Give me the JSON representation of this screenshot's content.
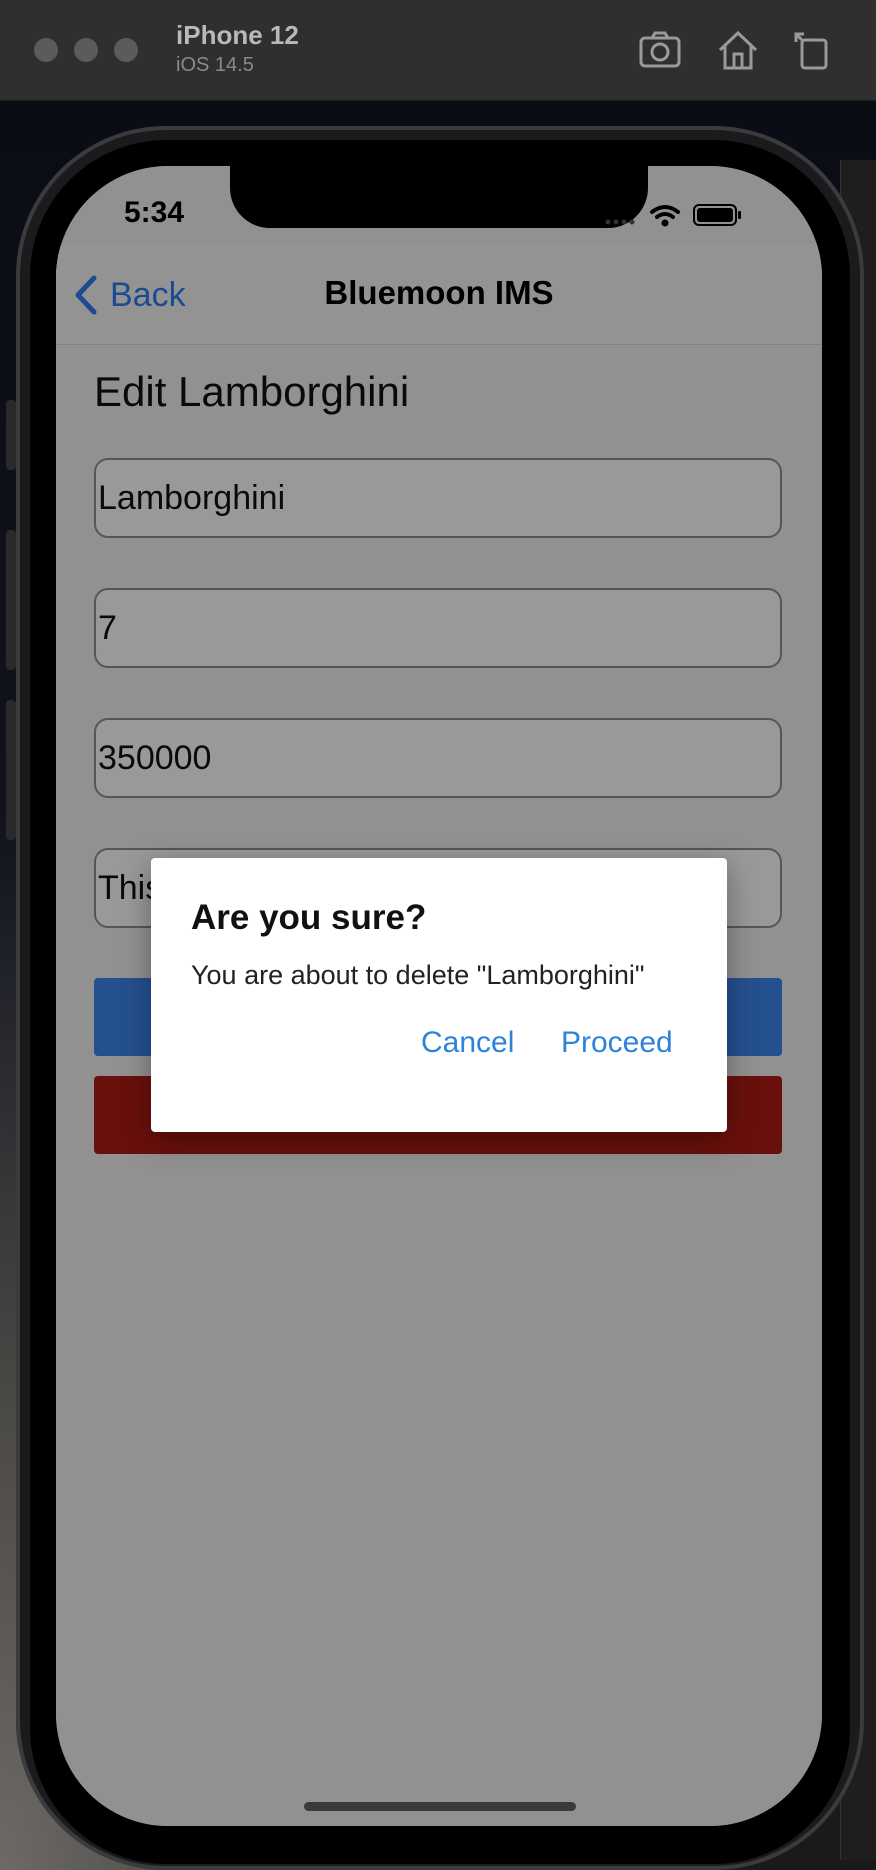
{
  "simulator": {
    "device": "iPhone 12",
    "os": "iOS 14.5",
    "icons": [
      "screenshot-icon",
      "home-icon",
      "rotate-icon"
    ]
  },
  "status_bar": {
    "time": "5:34",
    "icons": [
      "signal-dots-icon",
      "wifi-icon",
      "battery-icon"
    ]
  },
  "navbar": {
    "back_label": "Back",
    "title": "Bluemoon IMS"
  },
  "form": {
    "heading": "Edit Lamborghini",
    "name_value": "Lamborghini",
    "quantity_value": "7",
    "price_value": "350000",
    "description_value": "This"
  },
  "colors": {
    "accent": "#2f7cf6",
    "update_button": "#3f86f0",
    "delete_button": "#b11b12",
    "alert_link": "#2f82d9"
  },
  "alert": {
    "title": "Are you sure?",
    "message": "You are about to delete \"Lamborghini\"",
    "cancel_label": "Cancel",
    "proceed_label": "Proceed"
  }
}
